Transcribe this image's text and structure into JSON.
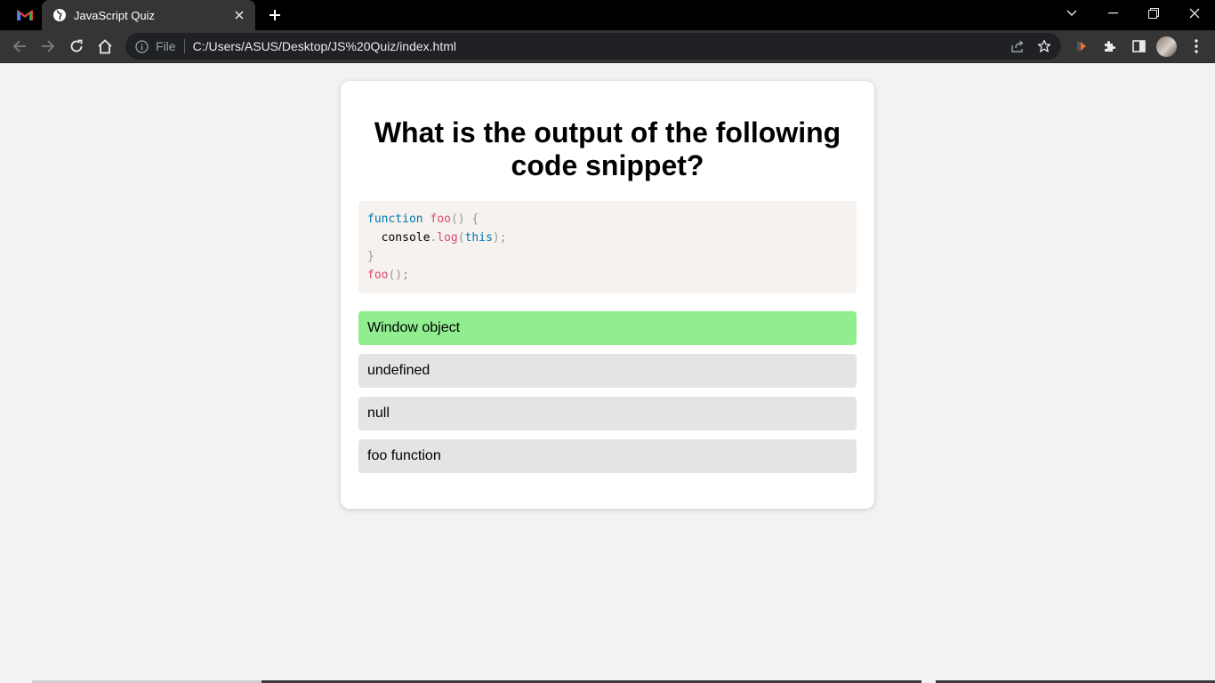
{
  "browser": {
    "tab_title": "JavaScript Quiz",
    "address_scheme": "File",
    "address_url": "C:/Users/ASUS/Desktop/JS%20Quiz/index.html"
  },
  "quiz": {
    "question": "What is the output of the following code snippet?",
    "code_lines": {
      "l1_kw": "function",
      "l1_fn": "foo",
      "l1_pn": "() {",
      "l2_a": "  console",
      "l2_dot": ".",
      "l2_fn": "log",
      "l2_p1": "(",
      "l2_kw": "this",
      "l2_p2": ");",
      "l3_pn": "}",
      "l4_fn": "foo",
      "l4_pn": "();"
    },
    "options": [
      {
        "label": "Window object",
        "state": "correct"
      },
      {
        "label": "undefined",
        "state": "default"
      },
      {
        "label": "null",
        "state": "default"
      },
      {
        "label": "foo function",
        "state": "default"
      }
    ]
  },
  "colors": {
    "correct_option": "#90ee90",
    "default_option": "#e4e4e4",
    "page_background": "#f2f2f2"
  }
}
